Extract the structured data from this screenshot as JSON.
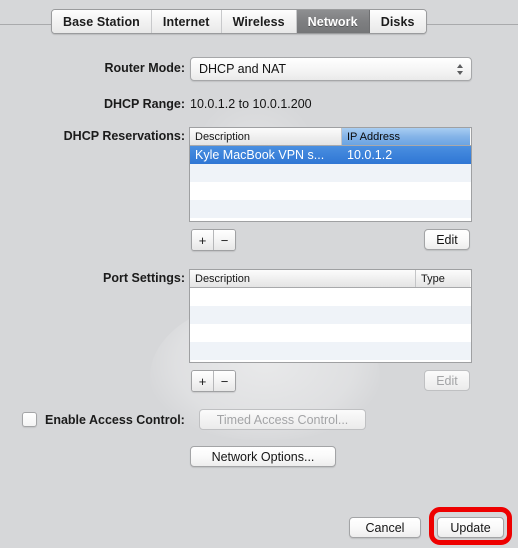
{
  "tabs": [
    {
      "label": "Base Station",
      "selected": false
    },
    {
      "label": "Internet",
      "selected": false
    },
    {
      "label": "Wireless",
      "selected": false
    },
    {
      "label": "Network",
      "selected": true
    },
    {
      "label": "Disks",
      "selected": false
    }
  ],
  "fields": {
    "router_mode_label": "Router Mode:",
    "router_mode_value": "DHCP and NAT",
    "dhcp_range_label": "DHCP Range:",
    "dhcp_range_value": "10.0.1.2 to 10.0.1.200",
    "dhcp_reservations_label": "DHCP Reservations:",
    "port_settings_label": "Port Settings:"
  },
  "dhcp_reservations": {
    "columns": [
      "Description",
      "IP Address"
    ],
    "sorted_column": "IP Address",
    "sort_direction": "ascending",
    "rows": [
      {
        "description": "Kyle MacBook VPN s...",
        "ip_address": "10.0.1.2",
        "selected": true
      }
    ],
    "empty_row_count": 4,
    "add_label": "+",
    "remove_label": "−",
    "edit_label": "Edit",
    "edit_enabled": true
  },
  "port_settings": {
    "columns": [
      "Description",
      "Type"
    ],
    "rows": [],
    "empty_row_count": 5,
    "add_label": "+",
    "remove_label": "−",
    "edit_label": "Edit",
    "edit_enabled": false
  },
  "access_control": {
    "checkbox_label": "Enable Access Control:",
    "checked": false,
    "timed_button_label": "Timed Access Control...",
    "timed_button_enabled": false
  },
  "network_options": {
    "label": "Network Options..."
  },
  "footer": {
    "cancel_label": "Cancel",
    "update_label": "Update"
  },
  "annotation": {
    "color": "#ee0000",
    "target": "Update"
  }
}
